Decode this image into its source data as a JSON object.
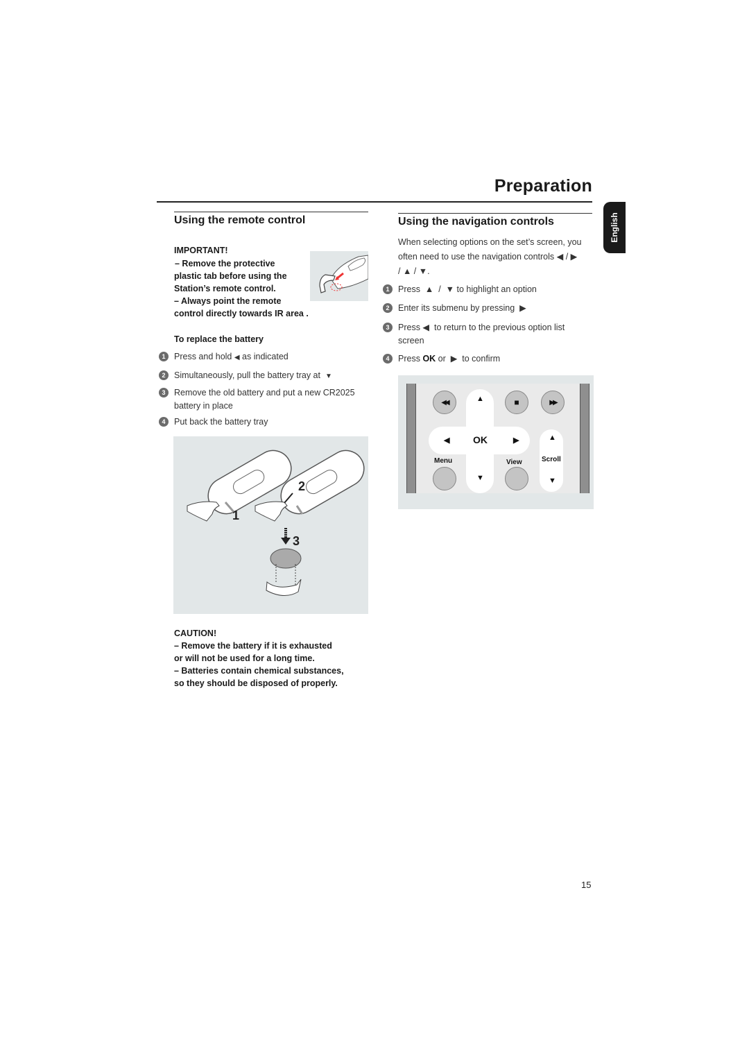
{
  "page": {
    "title": "Preparation",
    "language_tab": "English",
    "page_number": "15"
  },
  "remote_section": {
    "title": "Using the remote control",
    "important_heading": "IMPORTANT!",
    "important_lines": [
      "–  Remove the protective",
      "plastic tab before using the",
      "Station’s remote control.",
      "–  Always point the remote",
      "control directly towards IR area ."
    ],
    "battery_heading": "To replace the battery",
    "steps": [
      {
        "num": "1",
        "text_before": "Press and hold",
        "icon": "◀",
        "text_after": " as indicated"
      },
      {
        "num": "2",
        "text_before": "Simultaneously, pull the battery tray at",
        "icon": "▼",
        "text_after": ""
      },
      {
        "num": "3",
        "text_before": "Remove the old battery and put a new CR2025 battery in place",
        "icon": "",
        "text_after": ""
      },
      {
        "num": "4",
        "text_before": "Put back the battery tray",
        "icon": "",
        "text_after": ""
      }
    ],
    "illustration_labels": [
      "1",
      "2",
      "3"
    ],
    "caution_heading": "CAUTION!",
    "caution_lines": [
      "–  Remove the battery if it is exhausted",
      "or will not be used for a long time.",
      "–  Batteries contain chemical substances,",
      "so they should be disposed of properly."
    ]
  },
  "nav_section": {
    "title": "Using the navigation controls",
    "intro_line1": "When selecting options on the set’s screen, you",
    "intro_line2": "often need to use the navigation controls ◀ / ▶",
    "intro_line3": "/ ▲ / ▼.",
    "steps": [
      {
        "num": "1",
        "text": "Press  ▲  /  ▼ to highlight an option"
      },
      {
        "num": "2",
        "text": "Enter its submenu by pressing  ▶"
      },
      {
        "num": "3",
        "text": "Press ◀  to return to the previous option list",
        "text2": "screen"
      },
      {
        "num": "4",
        "text_before": "Press ",
        "bold": "OK",
        "text_after": " or  ▶  to confirm"
      }
    ],
    "panel": {
      "ok_label": "OK",
      "menu_label": "Menu",
      "view_label": "View",
      "scroll_label": "Scroll",
      "rewind_icon": "◀◀",
      "stop_icon": "■",
      "forward_icon": "▶▶",
      "up_icon": "▲",
      "down_icon": "▼",
      "left_icon": "◀",
      "right_icon": "▶"
    }
  }
}
